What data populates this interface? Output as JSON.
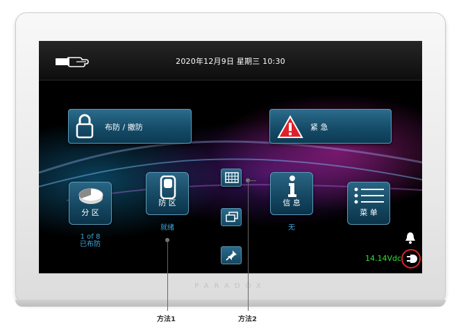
{
  "status_bar": {
    "datetime": "2020年12月9日 星期三 10:30",
    "left_icon": "hand-card-icon"
  },
  "buttons": {
    "arm_disarm": {
      "label": "布防 / 撤防",
      "icon": "lock-icon"
    },
    "emergency": {
      "label": "紧 急",
      "icon": "warning-icon"
    }
  },
  "tiles": {
    "partition": {
      "label": "分 区",
      "icon": "pie-chart-icon",
      "status_line1": "1 of 8",
      "status_line2": "已布防"
    },
    "zone": {
      "label": "防 区",
      "icon": "door-sensor-icon",
      "status": "就绪"
    },
    "info": {
      "label": "信 息",
      "icon": "info-icon",
      "status": "无"
    },
    "menu": {
      "label": "菜 单",
      "icon": "menu-list-icon"
    }
  },
  "small_buttons": [
    "keypad-grid-icon",
    "windows-icon",
    "pin-icon"
  ],
  "power": {
    "voltage": "14.14Vdc",
    "bell_icon": "bell-icon",
    "plug_icon": "power-plug-icon"
  },
  "brand_text": "PARADOX",
  "annotations": {
    "method1": "方法1",
    "method2": "方法2"
  },
  "colors": {
    "status_text": "#3aa8e0",
    "voltage": "#33e03a",
    "highlight_ring": "#e0202a",
    "button_blue": "#154c68"
  }
}
